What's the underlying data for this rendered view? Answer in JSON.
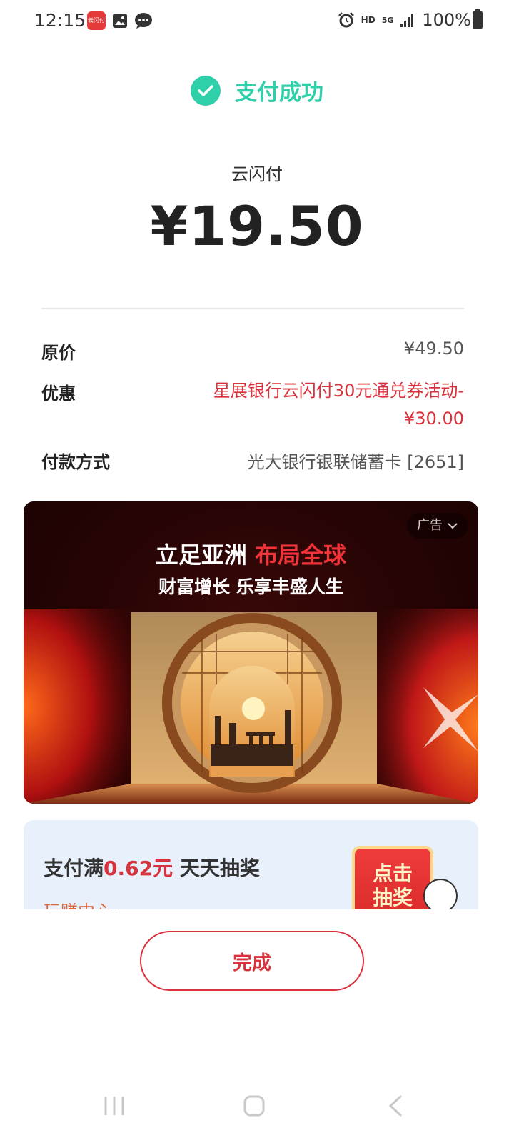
{
  "status_bar": {
    "time": "12:15",
    "app_badge": "云闪付",
    "hd": "HD",
    "network": "5G",
    "battery": "100%"
  },
  "result": {
    "title": "支付成功",
    "merchant": "云闪付",
    "amount": "¥19.50"
  },
  "details": {
    "original_label": "原价",
    "original_value": "¥49.50",
    "discount_label": "优惠",
    "discount_value_line1": "星展银行云闪付30元通兑券活动-",
    "discount_value_line2": "¥30.00",
    "payment_label": "付款方式",
    "payment_value": "光大银行银联储蓄卡 [2651]"
  },
  "ad": {
    "tag": "广告",
    "title_part1": "立足亚洲 ",
    "title_part2": "布局全球",
    "subtitle": "财富增长 乐享丰盛人生"
  },
  "lottery": {
    "text_prefix": "支付满",
    "amount": "0.62元",
    "text_suffix": " 天天抽奖",
    "link": "玩赚中心",
    "button_line1": "点击",
    "button_line2": "抽奖"
  },
  "actions": {
    "done": "完成"
  },
  "colors": {
    "success": "#2fcfa9",
    "accent_red": "#d8323c"
  }
}
